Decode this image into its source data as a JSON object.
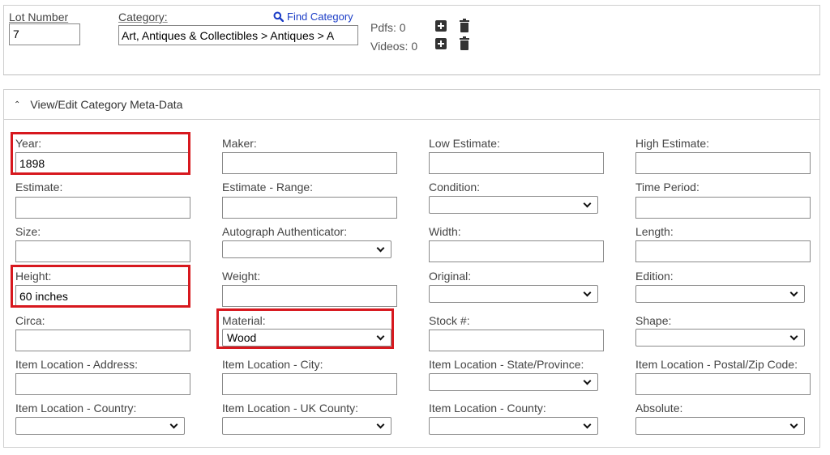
{
  "top": {
    "lot_number_label": "Lot Number",
    "lot_number_value": "7",
    "category_label": "Category:",
    "category_value": "Art, Antiques & Collectibles > Antiques > A",
    "find_category_label": "Find Category",
    "pdfs_label": "Pdfs: 0",
    "videos_label": "Videos: 0"
  },
  "meta": {
    "header_label": "View/Edit Category Meta-Data",
    "fields": {
      "year_label": "Year:",
      "year_value": "1898",
      "maker_label": "Maker:",
      "low_estimate_label": "Low Estimate:",
      "high_estimate_label": "High Estimate:",
      "estimate_label": "Estimate:",
      "estimate_range_label": "Estimate - Range:",
      "condition_label": "Condition:",
      "time_period_label": "Time Period:",
      "size_label": "Size:",
      "autograph_label": "Autograph Authenticator:",
      "width_label": "Width:",
      "length_label": "Length:",
      "height_label": "Height:",
      "height_value": "60 inches",
      "weight_label": "Weight:",
      "original_label": "Original:",
      "edition_label": "Edition:",
      "circa_label": "Circa:",
      "material_label": "Material:",
      "material_value": "Wood",
      "stock_label": "Stock #:",
      "shape_label": "Shape:",
      "address_label": "Item Location - Address:",
      "city_label": "Item Location - City:",
      "state_label": "Item Location - State/Province:",
      "postal_label": "Item Location - Postal/Zip Code:",
      "country_label": "Item Location - Country:",
      "uk_county_label": "Item Location - UK County:",
      "county_label": "Item Location - County:",
      "absolute_label": "Absolute:"
    }
  },
  "colors": {
    "highlight": "#d7181e",
    "link": "#1a3cc6"
  },
  "icons": [
    "search-icon",
    "plus-icon",
    "trash-icon",
    "chevron-up-icon",
    "chevron-down-icon"
  ]
}
